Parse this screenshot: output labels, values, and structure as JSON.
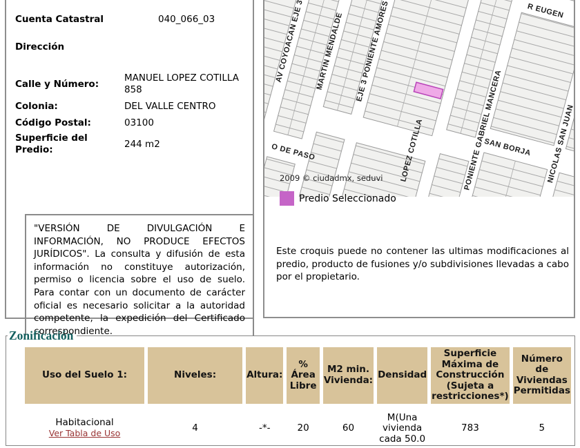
{
  "left_panel": {
    "cuenta_label": "Cuenta Catastral",
    "cuenta_value": "040_066_03",
    "direccion_label": "Dirección",
    "fields": [
      {
        "label": "Calle y Número:",
        "value": "MANUEL LOPEZ COTILLA 858"
      },
      {
        "label": "Colonia:",
        "value": "DEL VALLE CENTRO"
      },
      {
        "label": "Código Postal:",
        "value": "03100"
      },
      {
        "label": "Superficie del Predio:",
        "value": "244 m2"
      }
    ],
    "disclaimer": "\"VERSIÓN DE DIVULGACIÓN E INFORMACIÓN, NO PRODUCE EFECTOS JURÍDICOS\". La consulta y difusión de esta información no constituye autorización, permiso o licencia sobre el uso de suelo. Para contar con un documento de carácter oficial es necesario solicitar a la autoridad competente, la expedición del Certificado correspondiente."
  },
  "map_panel": {
    "copyright": "2009 © ciudadmx, seduvi",
    "legend_label": "Predio Seleccionado",
    "legend_color": "#c565c7",
    "selected_parcel_fill": "#efa9e7",
    "selected_parcel_border": "#b843b8",
    "note": "Este croquis puede no contener las ultimas modificaciones al predio, producto de fusiones y/o subdivisiones llevadas a cabo por el propietario.",
    "streets": [
      "AV COYOACAN EJE 3",
      "MARTIN MENDALDE",
      "EJE 3 PONIENTE AMORES",
      "LOPEZ COTILLA",
      "PONIENTE GABRIEL MANCERA",
      "SAN BORJA",
      "NICOLAS SAN JUAN",
      "O DE PASO",
      "R EUGEN"
    ]
  },
  "zonificacion": {
    "title": "Zonificación",
    "title_color": "#14605f",
    "header_bg": "#d8c39a",
    "headers": [
      "Uso del Suelo 1:",
      "Niveles:",
      "Altura:",
      "% Área Libre",
      "M2 min. Vivienda:",
      "Densidad",
      "Superficie Máxima de Construcción (Sujeta a restricciones*)",
      "Número de Viviendas Permitidas"
    ],
    "row": {
      "uso": "Habitacional",
      "uso_link": "Ver Tabla de Uso",
      "niveles": "4",
      "altura": "-*-",
      "area_libre": "20",
      "m2_min": "60",
      "densidad": "M(Una vivienda cada 50.0",
      "superficie_max": "783",
      "viviendas": "5"
    }
  }
}
